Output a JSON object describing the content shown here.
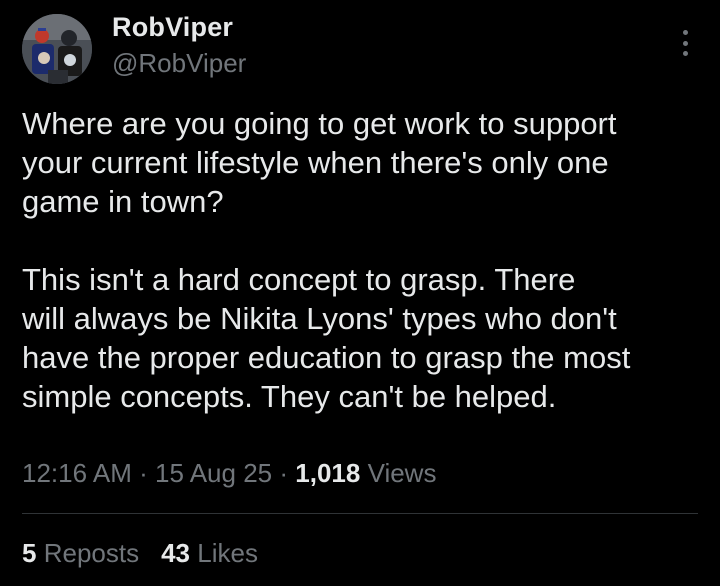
{
  "author": {
    "display_name": "RobViper",
    "handle": "@RobViper",
    "avatar_icon": "profile-photo"
  },
  "tweet": {
    "text": "Where are you going to get work to support\nyour current lifestyle when there's only one\ngame in town?\n\nThis isn't a hard concept to grasp. There\nwill always be Nikita Lyons' types who don't\nhave the proper education to grasp the most\nsimple concepts. They can't be helped.",
    "time": "12:16 AM",
    "date": "15 Aug 25",
    "views_count": "1,018",
    "views_label": "Views",
    "separator": "·"
  },
  "stats": {
    "reposts_count": "5",
    "reposts_label": "Reposts",
    "likes_count": "43",
    "likes_label": "Likes"
  },
  "menu": {
    "more_icon": "more-vertical-icon"
  },
  "colors": {
    "background": "#000000",
    "primary_text": "#e7e9ea",
    "secondary_text": "#71767b",
    "divider": "#2f3336"
  }
}
